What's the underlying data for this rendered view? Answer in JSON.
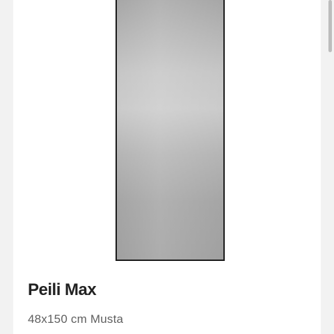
{
  "product": {
    "title": "Peili Max",
    "subtitle": "48x150 cm Musta",
    "image_icon": "mirror-image"
  },
  "colors": {
    "background": "#f2f2f2",
    "card": "#ffffff",
    "frame": "#1a1a1a",
    "title": "#222222",
    "subtitle": "#5f5f5f"
  },
  "scrollbar": {
    "position_fraction": 0.0
  }
}
